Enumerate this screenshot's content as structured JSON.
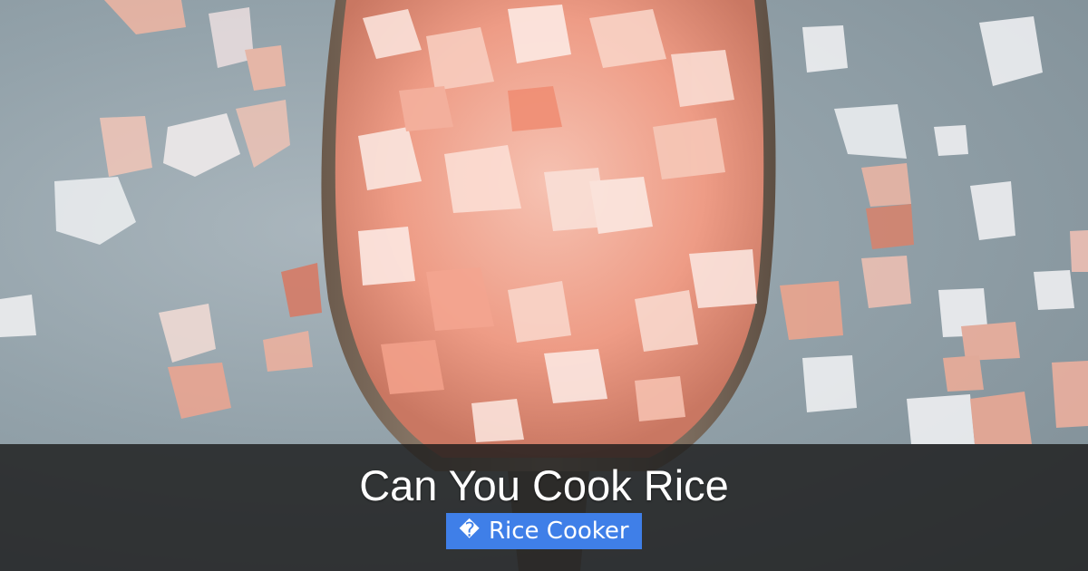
{
  "title": "Can You Cook Rice",
  "category": {
    "label": "Rice Cooker",
    "icon": "tag-icon",
    "icon_glyph": "�"
  },
  "colors": {
    "overlay": "#1c1c1c",
    "badge": "#3f7fe8",
    "text": "#ffffff",
    "salt": "#f3a590",
    "background": "#93a2aa"
  }
}
